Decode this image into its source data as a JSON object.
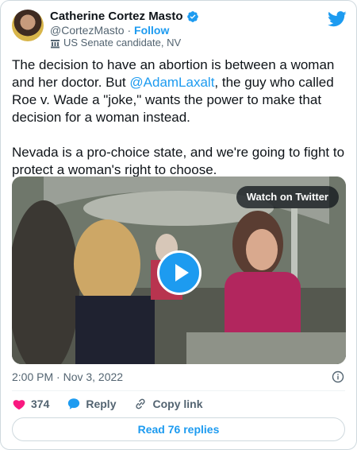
{
  "author": {
    "name": "Catherine Cortez Masto",
    "handle": "@CortezMasto",
    "separator": "·",
    "follow_label": "Follow",
    "account_label": "US Senate candidate, NV"
  },
  "tweet": {
    "paragraph1_before": "The decision to have an abortion is between a woman and her doctor. But ",
    "mention": "@AdamLaxalt",
    "paragraph1_after": ", the guy who called Roe v. Wade a \"joke,\" wants the power to make that decision for a woman instead.",
    "paragraph2": "Nevada is a pro-choice state, and we're going to fight to protect a woman's right to choose."
  },
  "media": {
    "watch_label": "Watch on Twitter"
  },
  "meta": {
    "timestamp": "2:00 PM · Nov 3, 2022"
  },
  "actions": {
    "like_count": "374",
    "reply_label": "Reply",
    "copy_label": "Copy link"
  },
  "footer": {
    "read_replies_label": "Read 76 replies"
  },
  "colors": {
    "accent": "#1d9bf0",
    "like": "#f91880",
    "muted": "#536471"
  },
  "icons": [
    "verified-badge-icon",
    "twitter-bird-icon",
    "government-building-icon",
    "play-icon",
    "info-icon",
    "heart-icon",
    "reply-bubble-icon",
    "link-icon"
  ]
}
